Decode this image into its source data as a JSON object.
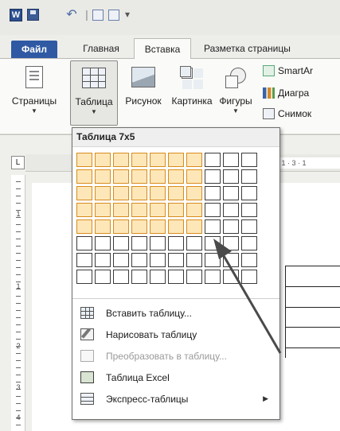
{
  "qat": {
    "logo_text": "W",
    "undo_glyph": "↶",
    "separator_glyph": "|",
    "more_glyph": "▾"
  },
  "tabs": {
    "file": "Файл",
    "home": "Главная",
    "insert": "Вставка",
    "layout": "Разметка страницы"
  },
  "ribbon": {
    "pages": "Страницы",
    "table": "Таблица",
    "picture": "Рисунок",
    "clipart": "Картинка",
    "shapes": "Фигуры",
    "smartart": "SmartAr",
    "chart": "Диагра",
    "screenshot": "Снимок",
    "dropdown_arrow": "▼"
  },
  "ruler": {
    "corner_glyph": "L",
    "marks": "· 1 · 3 · 1",
    "vertical_numbers": [
      "1",
      "1",
      "2",
      "3",
      "4"
    ]
  },
  "table_menu": {
    "title": "Таблица 7x5",
    "grid": {
      "cols": 10,
      "rows": 8,
      "selected_cols": 7,
      "selected_rows": 5
    },
    "items": [
      {
        "label": "Вставить таблицу...",
        "icon": "insert-table-icon",
        "enabled": true,
        "submenu": false
      },
      {
        "label": "Нарисовать таблицу",
        "icon": "draw-table-icon",
        "enabled": true,
        "submenu": false
      },
      {
        "label": "Преобразовать в таблицу...",
        "icon": "convert-table-icon",
        "enabled": false,
        "submenu": false
      },
      {
        "label": "Таблица Excel",
        "icon": "excel-table-icon",
        "enabled": true,
        "submenu": false
      },
      {
        "label": "Экспресс-таблицы",
        "icon": "quick-tables-icon",
        "enabled": true,
        "submenu": true
      }
    ],
    "submenu_glyph": "▶"
  },
  "colors": {
    "file_tab": "#2f5aa3",
    "grid_border": "#3a3a3a",
    "selection_fill": "#fde7b8",
    "pointer": "#4a4a4a"
  }
}
